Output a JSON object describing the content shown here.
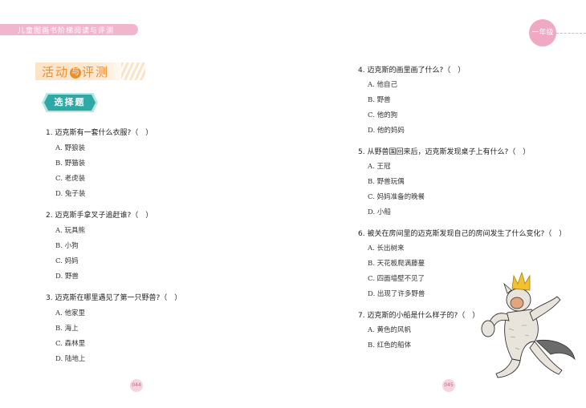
{
  "header": {
    "series_title": "儿童图画书阶梯阅读与评测",
    "grade": "一年级"
  },
  "section": {
    "activity_title_a": "活动",
    "activity_title_mid": "与",
    "activity_title_b": "评测",
    "choice_label": "选择题"
  },
  "left_questions": [
    {
      "q": "1. 迈克斯有一套什么衣服?（　）",
      "options": [
        "A. 野狼装",
        "B. 野猫装",
        "C. 老虎装",
        "D. 兔子装"
      ]
    },
    {
      "q": "2. 迈克斯手拿叉子追赶谁?（　）",
      "options": [
        "A. 玩具熊",
        "B. 小狗",
        "C. 妈妈",
        "D. 野兽"
      ]
    },
    {
      "q": "3. 迈克斯在哪里遇见了第一只野兽?（　）",
      "options": [
        "A. 他家里",
        "B. 海上",
        "C. 森林里",
        "D. 陆地上"
      ]
    }
  ],
  "right_questions": [
    {
      "q": "4. 迈克斯的画里画了什么?（　）",
      "options": [
        "A. 他自己",
        "B. 野兽",
        "C. 他的狗",
        "D. 他的妈妈"
      ]
    },
    {
      "q": "5. 从野兽国回来后，迈克斯发现桌子上有什么?（　）",
      "options": [
        "A. 王冠",
        "B. 野兽玩偶",
        "C. 妈妈准备的晚餐",
        "D. 小船"
      ]
    },
    {
      "q": "6. 被关在房间里的迈克斯发现自己的房间发生了什么变化?（　）",
      "options": [
        "A. 长出树来",
        "B. 天花板爬满藤蔓",
        "C. 四面墙壁不见了",
        "D. 出现了许多野兽"
      ]
    },
    {
      "q": "7. 迈克斯的小船是什么样子的?（　）",
      "options": [
        "A. 黄色的风帆",
        "B. 红色的船体"
      ]
    }
  ],
  "page_numbers": {
    "left": "044",
    "right": "045"
  },
  "colors": {
    "pink": "#f2b6cc",
    "teal": "#2fa9a6",
    "orange": "#e8902f"
  }
}
